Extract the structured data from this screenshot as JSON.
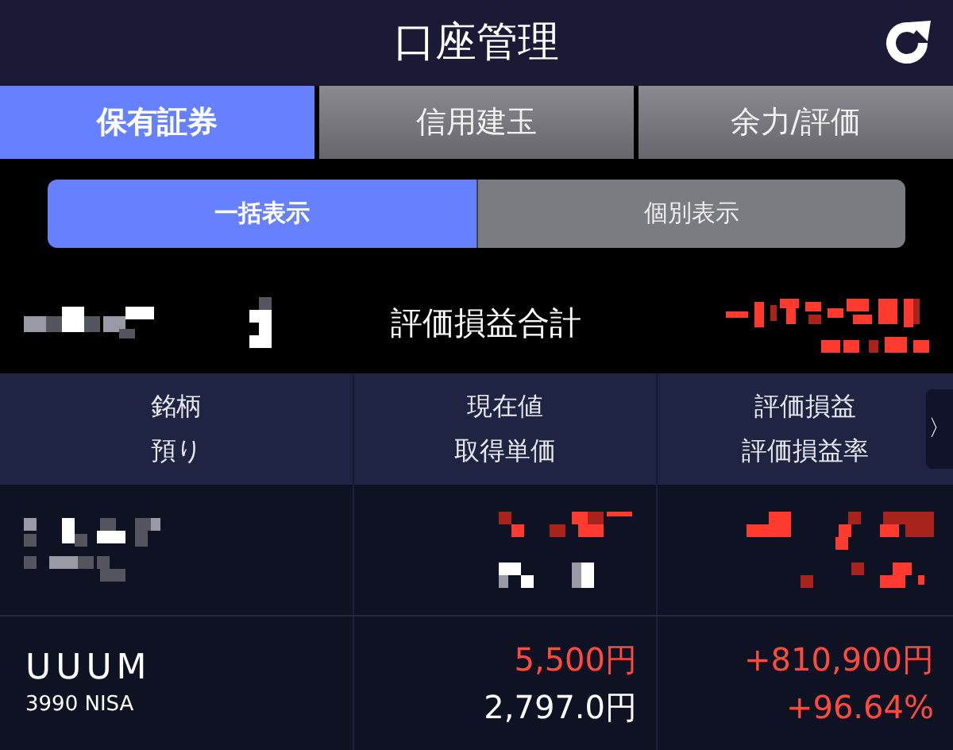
{
  "header": {
    "title": "口座管理"
  },
  "tabs": [
    {
      "label": "保有証券",
      "selected": true
    },
    {
      "label": "信用建玉",
      "selected": false
    },
    {
      "label": "余力/評価",
      "selected": false
    }
  ],
  "view_toggle": [
    {
      "label": "一括表示",
      "selected": true
    },
    {
      "label": "個別表示",
      "selected": false
    }
  ],
  "summary": {
    "label": "評価損益合計",
    "redacted": true
  },
  "table": {
    "columns": [
      {
        "top": "銘柄",
        "bottom": "預り"
      },
      {
        "top": "現在値",
        "bottom": "取得単価"
      },
      {
        "top": "評価損益",
        "bottom": "評価損益率"
      }
    ],
    "scroll_button": "〉",
    "rows": [
      {
        "kind": "redacted"
      },
      {
        "kind": "stock",
        "name": "UUUM",
        "code": "3990 NISA",
        "price": "5,500円",
        "cost": "2,797.0円",
        "profit": "+810,900円",
        "profit_rate": "+96.64%"
      }
    ]
  }
}
